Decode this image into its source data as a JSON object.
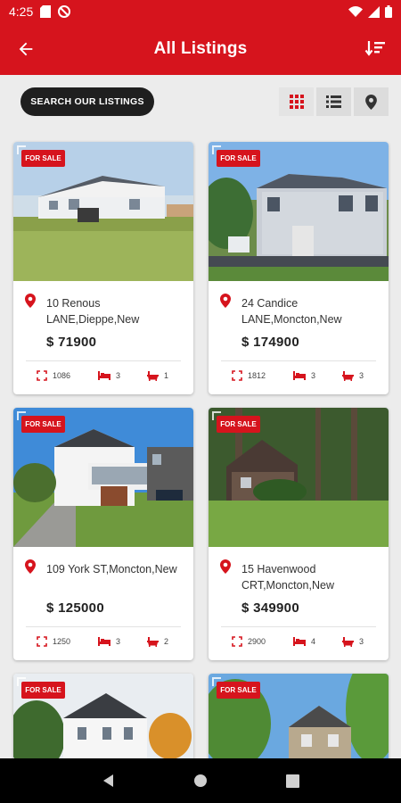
{
  "status_bar": {
    "time": "4:25",
    "icons": [
      "sd-card-icon",
      "no-disturb-icon",
      "wifi-icon",
      "signal-icon",
      "battery-icon"
    ]
  },
  "app_bar": {
    "title": "All Listings",
    "back_icon": "arrow-left-icon",
    "sort_icon": "sort-icon"
  },
  "toolbar": {
    "search_label": "SEARCH OUR LISTINGS",
    "views": [
      {
        "name": "grid-view",
        "icon": "grid-icon",
        "active": true
      },
      {
        "name": "list-view",
        "icon": "list-icon",
        "active": false
      },
      {
        "name": "map-view",
        "icon": "map-pin-icon",
        "active": false
      }
    ]
  },
  "colors": {
    "brand_red": "#d6141d",
    "dark_button": "#1f1f1f",
    "background": "#ececec"
  },
  "listings": [
    {
      "badge": "FOR SALE",
      "address": "10 Renous LANE,Dieppe,New",
      "price": "$ 71900",
      "area": "1086",
      "beds": "3",
      "baths": "1"
    },
    {
      "badge": "FOR SALE",
      "address": "24 Candice LANE,Moncton,New",
      "price": "$ 174900",
      "area": "1812",
      "beds": "3",
      "baths": "3"
    },
    {
      "badge": "FOR SALE",
      "address": "109 York ST,Moncton,New",
      "price": "$ 125000",
      "area": "1250",
      "beds": "3",
      "baths": "2"
    },
    {
      "badge": "FOR SALE",
      "address": "15 Havenwood CRT,Moncton,New",
      "price": "$ 349900",
      "area": "2900",
      "beds": "4",
      "baths": "3"
    },
    {
      "badge": "FOR SALE"
    },
    {
      "badge": "FOR SALE"
    }
  ],
  "nav_bar": {
    "buttons": [
      "back-triangle-icon",
      "home-circle-icon",
      "recents-square-icon"
    ]
  }
}
